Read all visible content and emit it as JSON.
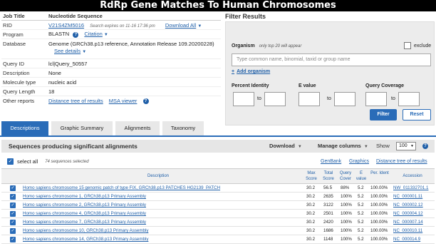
{
  "banner": "RdRp Gene Matches To Human Chromosomes",
  "job": {
    "header_label": "Job Title",
    "header_value": "Nucleotide Sequence",
    "rid_label": "RID",
    "rid_value": "V21S4ZM5016",
    "rid_expiry": "Search expires on 11-16 17:36 pm",
    "download_all": "Download All",
    "program_label": "Program",
    "program_value": "BLASTN",
    "citation": "Citation",
    "database_label": "Database",
    "database_value": "Genome (GRCh38.p13 reference, Annotation Release 109.20200228)",
    "see_details": "See details",
    "query_id_label": "Query ID",
    "query_id_value": "lcl|Query_50557",
    "description_label": "Description",
    "description_value": "None",
    "molecule_label": "Molecule type",
    "molecule_value": "nucleic acid",
    "qlength_label": "Query Length",
    "qlength_value": "18",
    "reports_label": "Other reports",
    "distance_tree": "Distance tree of results",
    "msa_viewer": "MSA viewer"
  },
  "filter": {
    "title": "Filter Results",
    "organism_label": "Organism",
    "organism_hint": "only top 20 will appear",
    "exclude_label": "exclude",
    "organism_placeholder": "Type common name, binomial, taxid or group name",
    "add_organism": "Add organism",
    "percent_identity_label": "Percent Identity",
    "evalue_label": "E value",
    "query_coverage_label": "Query Coverage",
    "to_label": "to",
    "filter_button": "Filter",
    "reset_button": "Reset"
  },
  "tabs": [
    "Descriptions",
    "Graphic Summary",
    "Alignments",
    "Taxonomy"
  ],
  "results": {
    "title": "Sequences producing significant alignments",
    "download": "Download",
    "manage_columns": "Manage columns",
    "show_label": "Show",
    "show_value": "100",
    "select_all": "select all",
    "selected_count": "74 sequences selected",
    "genbank": "GenBank",
    "graphics": "Graphics",
    "distance_tree": "Distance tree of results",
    "columns": {
      "description": "Description",
      "max_score": "Max Score",
      "total_score": "Total Score",
      "query_cover": "Query Cover",
      "evalue": "E value",
      "per_ident": "Per. Ident",
      "accession": "Accession"
    },
    "rows": [
      {
        "description": "Homo sapiens chromosome 15 genomic patch of type FIX, GRCh38.p13 PATCHES HG2139_PATCH",
        "max": "30.2",
        "total": "56.5",
        "cover": "88%",
        "evalue": "5.2",
        "ident": "100.00%",
        "acc": "NW_011332701.1"
      },
      {
        "description": "Homo sapiens chromosome 1, GRCh38.p13 Primary Assembly",
        "max": "30.2",
        "total": "2635",
        "cover": "100%",
        "evalue": "5.2",
        "ident": "100.00%",
        "acc": "NC_000001.11"
      },
      {
        "description": "Homo sapiens chromosome 2, GRCh38.p13 Primary Assembly",
        "max": "30.2",
        "total": "3122",
        "cover": "100%",
        "evalue": "5.2",
        "ident": "100.00%",
        "acc": "NC_000002.12"
      },
      {
        "description": "Homo sapiens chromosome 4, GRCh38.p13 Primary Assembly",
        "max": "30.2",
        "total": "2501",
        "cover": "100%",
        "evalue": "5.2",
        "ident": "100.00%",
        "acc": "NC_000004.12"
      },
      {
        "description": "Homo sapiens chromosome 7, GRCh38.p13 Primary Assembly",
        "max": "30.2",
        "total": "2420",
        "cover": "100%",
        "evalue": "5.2",
        "ident": "100.00%",
        "acc": "NC_000007.14"
      },
      {
        "description": "Homo sapiens chromosome 10, GRCh38.p13 Primary Assembly",
        "max": "30.2",
        "total": "1686",
        "cover": "100%",
        "evalue": "5.2",
        "ident": "100.00%",
        "acc": "NC_000010.11"
      },
      {
        "description": "Homo sapiens chromosome 14, GRCh38.p13 Primary Assembly",
        "max": "30.2",
        "total": "1148",
        "cover": "100%",
        "evalue": "5.2",
        "ident": "100.00%",
        "acc": "NC_000014.9"
      }
    ]
  }
}
